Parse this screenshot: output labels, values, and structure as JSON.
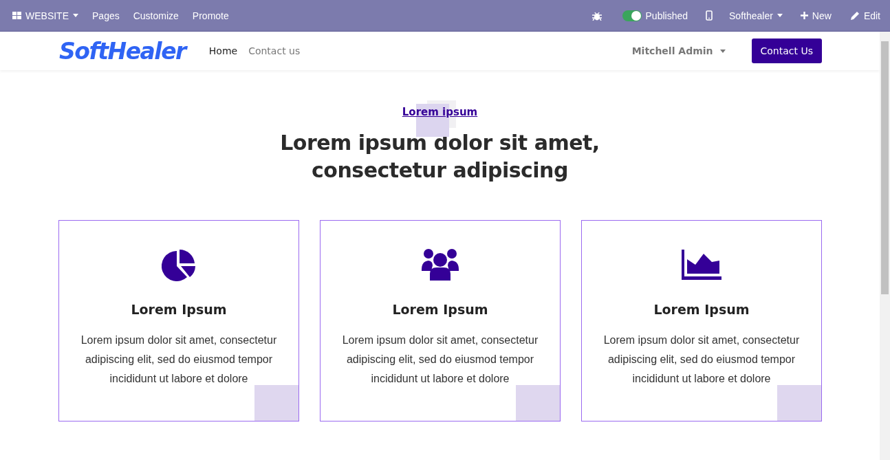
{
  "admin_bar": {
    "left": [
      {
        "kind": "apps",
        "label": "WEBSITE"
      },
      {
        "kind": "link",
        "label": "Pages"
      },
      {
        "kind": "link",
        "label": "Customize"
      },
      {
        "kind": "link",
        "label": "Promote"
      }
    ],
    "published": {
      "label": "Published",
      "on": true
    },
    "site": "Softhealer",
    "new_label": "New",
    "edit_label": "Edit"
  },
  "header": {
    "logo": "SoftHealer",
    "nav": [
      {
        "label": "Home",
        "selected": true
      },
      {
        "label": "Contact us",
        "selected": false
      }
    ],
    "user": "Mitchell Admin",
    "cta": "Contact Us"
  },
  "hero": {
    "kicker": "Lorem ipsum",
    "title": "Lorem ipsum dolor sit amet, consectetur adipiscing"
  },
  "cards": [
    {
      "kind": "pie",
      "title": "Lorem Ipsum",
      "text": "Lorem ipsum dolor sit amet, consectetur adipiscing elit, sed do eiusmod tempor incididunt ut labore et dolore"
    },
    {
      "kind": "users",
      "title": "Lorem Ipsum",
      "text": "Lorem ipsum dolor sit amet, consectetur adipiscing elit, sed do eiusmod tempor incididunt ut labore et dolore"
    },
    {
      "kind": "area",
      "title": "Lorem Ipsum",
      "text": "Lorem ipsum dolor sit amet, consectetur adipiscing elit, sed do eiusmod tempor incididunt ut labore et dolore"
    }
  ]
}
